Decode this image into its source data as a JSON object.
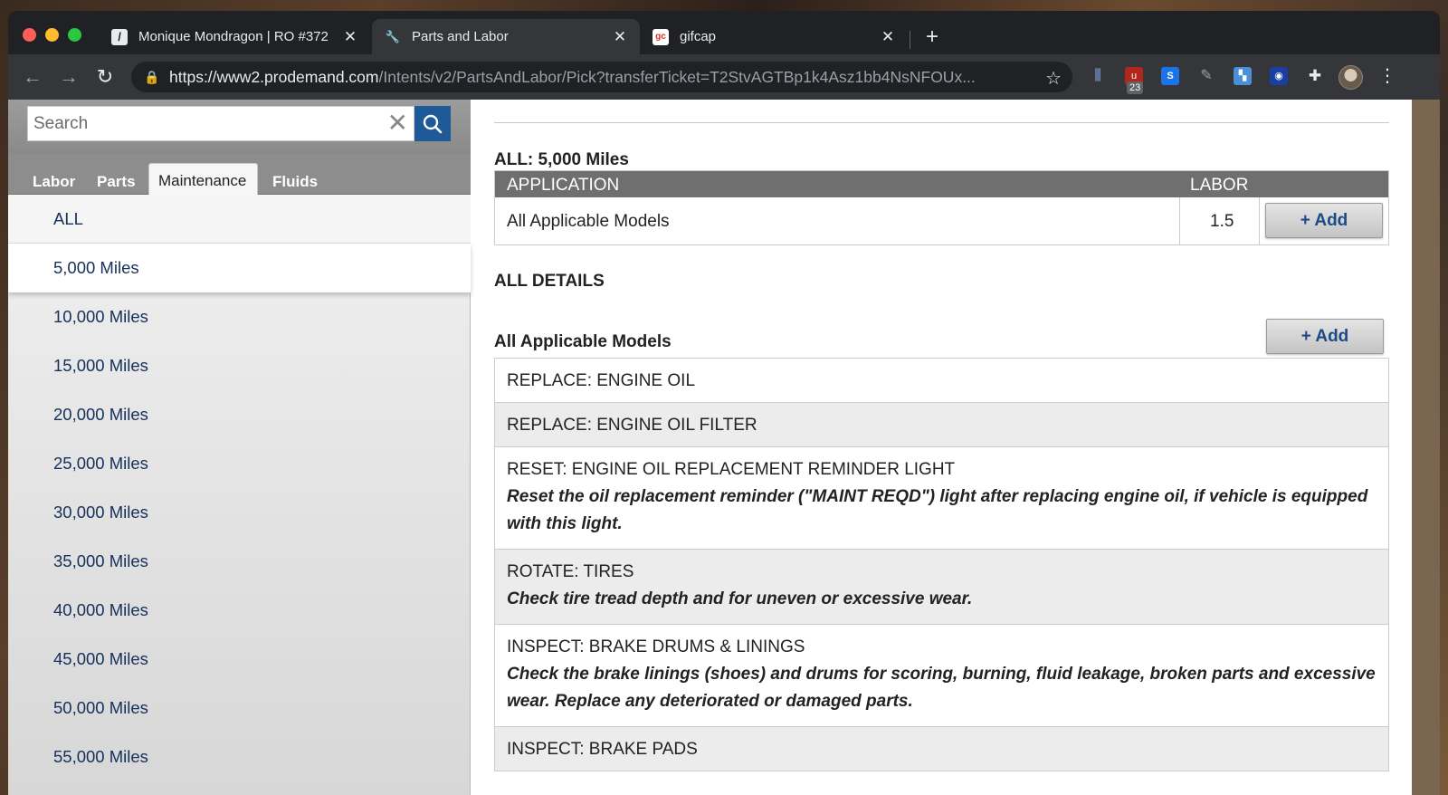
{
  "browser": {
    "tabs": [
      {
        "title": "Monique Mondragon | RO #372",
        "favicon": "wrench-logo-icon",
        "active": false
      },
      {
        "title": "Parts and Labor",
        "favicon": "wrench-icon",
        "active": true
      },
      {
        "title": "gifcap",
        "favicon": "gifcap-icon",
        "active": false
      }
    ],
    "url_host": "https://www2.prodemand.com",
    "url_path": "/Intents/v2/PartsAndLabor/Pick?transferTicket=T2StvAGTBp1k4Asz1bb4NsNFOUx...",
    "extension_badge": "23"
  },
  "sidebar": {
    "search_placeholder": "Search",
    "tabs": [
      "Labor",
      "Parts",
      "Maintenance",
      "Fluids"
    ],
    "active_tab": "Maintenance",
    "items": [
      "ALL",
      "5,000 Miles",
      "10,000 Miles",
      "15,000 Miles",
      "20,000 Miles",
      "25,000 Miles",
      "30,000 Miles",
      "35,000 Miles",
      "40,000 Miles",
      "45,000 Miles",
      "50,000 Miles",
      "55,000 Miles"
    ],
    "selected_item": "5,000 Miles"
  },
  "main": {
    "section_title": "ALL: 5,000 Miles",
    "labor_table": {
      "headers": [
        "APPLICATION",
        "LABOR"
      ],
      "rows": [
        {
          "application": "All Applicable Models",
          "labor": "1.5",
          "add_label": "+ Add"
        }
      ]
    },
    "details_title": "ALL DETAILS",
    "models_title": "All Applicable Models",
    "models_add_label": "+ Add",
    "details": [
      {
        "op": "REPLACE: ENGINE OIL",
        "note": ""
      },
      {
        "op": "REPLACE: ENGINE OIL FILTER",
        "note": ""
      },
      {
        "op": "RESET: ENGINE OIL REPLACEMENT REMINDER LIGHT",
        "note": "Reset the oil replacement reminder (\"MAINT REQD\") light after replacing engine oil, if vehicle is equipped with this light."
      },
      {
        "op": "ROTATE: TIRES",
        "note": "Check tire tread depth and for uneven or excessive wear."
      },
      {
        "op": "INSPECT: BRAKE DRUMS & LININGS",
        "note": "Check the brake linings (shoes) and drums for scoring, burning, fluid leakage, broken parts and excessive wear. Replace any deteriorated or damaged parts."
      },
      {
        "op": "INSPECT: BRAKE PADS",
        "note": ""
      }
    ]
  },
  "colors": {
    "accent": "#1e5a98",
    "link_text": "#15305a",
    "add_text": "#1c4a85",
    "table_header": "#6f6f6f"
  }
}
